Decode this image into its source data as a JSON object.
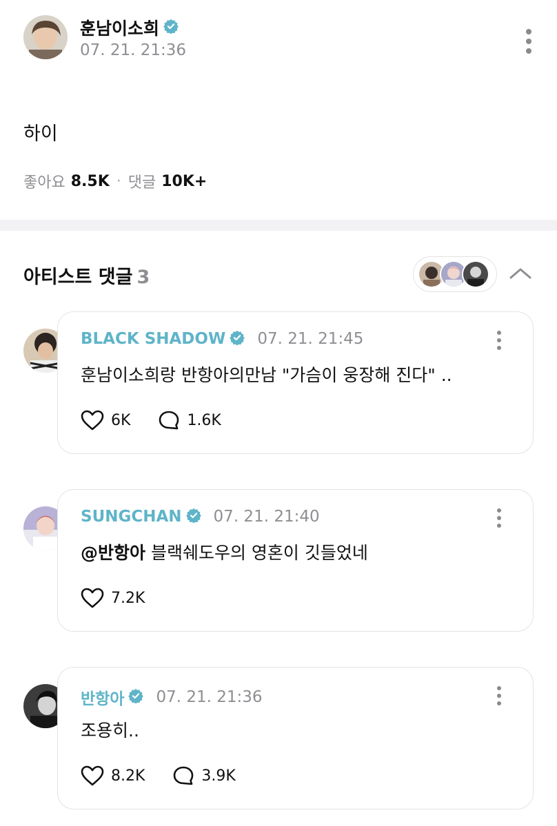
{
  "post": {
    "author": "훈남이소희",
    "time": "07. 21. 21:36",
    "body": "하이",
    "likes_label": "좋아요",
    "likes_value": "8.5K",
    "separator": "·",
    "comments_label": "댓글",
    "comments_value": "10K+"
  },
  "section": {
    "title": "아티스트 댓글",
    "count": "3"
  },
  "comments": [
    {
      "name": "BLACK SHADOW",
      "time": "07. 21. 21:45",
      "text": "훈남이소희랑 반항아의만남 \"가슴이 웅장해 진다\" ..",
      "likes": "6K",
      "replies": "1.6K"
    },
    {
      "name": "SUNGCHAN",
      "time": "07. 21. 21:40",
      "mention": "@반항아",
      "text": " 블랙쉐도우의 영혼이 깃들었네",
      "likes": "7.2K"
    },
    {
      "name": "반항아",
      "time": "07. 21. 21:36",
      "text": "조용히..",
      "likes": "8.2K",
      "replies": "3.9K"
    }
  ],
  "colors": {
    "accent": "#5fb4c9",
    "muted": "#8e8e93",
    "divider": "#f2f2f4"
  }
}
